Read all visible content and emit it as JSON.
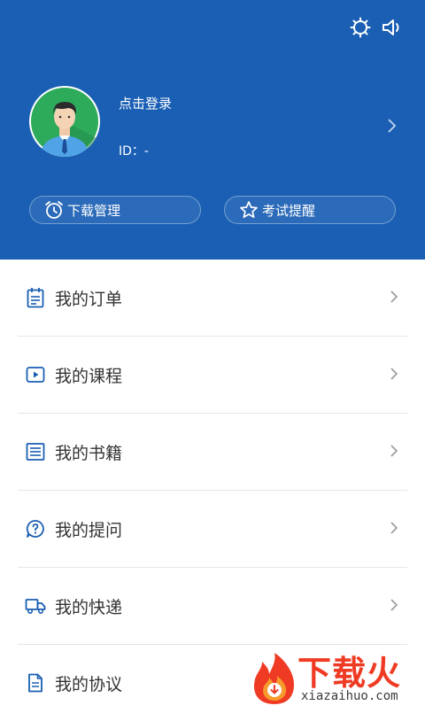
{
  "header": {
    "login_label": "点击登录",
    "id_label": "ID：-",
    "icons": [
      "settings-icon",
      "volume-icon"
    ],
    "background_color": "#1a5fb3",
    "actions": [
      {
        "label": "下载管理",
        "icon": "alarm-clock-icon"
      },
      {
        "label": "考试提醒",
        "icon": "star-icon"
      }
    ]
  },
  "menu": {
    "items": [
      {
        "label": "我的订单",
        "icon": "clipboard-icon"
      },
      {
        "label": "我的课程",
        "icon": "play-icon"
      },
      {
        "label": "我的书籍",
        "icon": "book-icon"
      },
      {
        "label": "我的提问",
        "icon": "question-icon"
      },
      {
        "label": "我的快递",
        "icon": "truck-icon"
      },
      {
        "label": "我的协议",
        "icon": "document-icon"
      }
    ]
  },
  "watermark": {
    "brand": "下载火",
    "url": "xiazaihuo.com"
  }
}
